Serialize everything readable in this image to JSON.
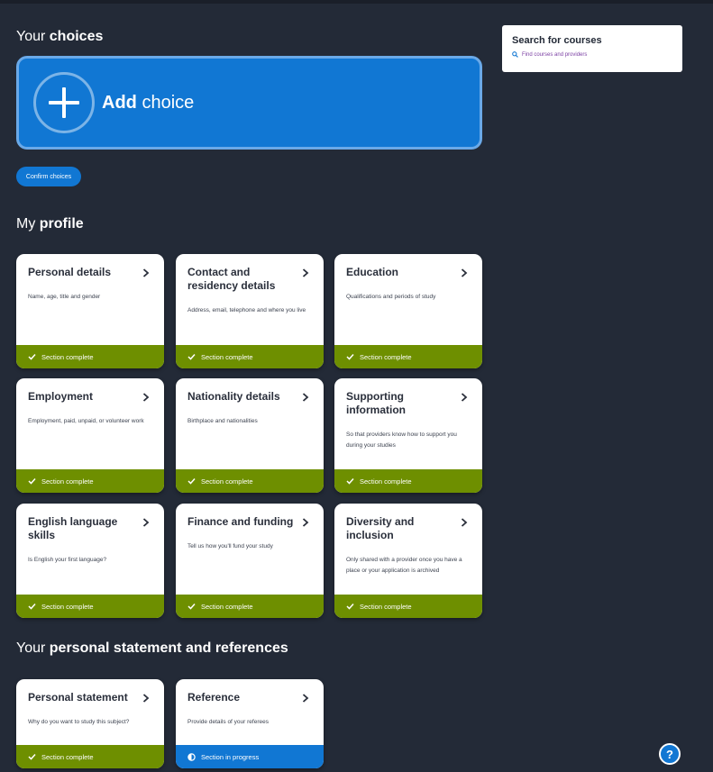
{
  "choices": {
    "heading_prefix": "Your",
    "heading_bold": "choices",
    "add_choice_bold": "Add",
    "add_choice_rest": "choice",
    "confirm_label": "Confirm choices"
  },
  "search": {
    "title": "Search for courses",
    "link": "Find courses and providers"
  },
  "profile": {
    "heading_prefix": "My",
    "heading_bold": "profile",
    "cards": [
      {
        "title": "Personal details",
        "desc": "Name, age, title and gender",
        "status": "Section complete"
      },
      {
        "title": "Contact and residency details",
        "desc": "Address, email, telephone and where you live",
        "status": "Section complete"
      },
      {
        "title": "Education",
        "desc": "Qualifications and periods of study",
        "status": "Section complete"
      },
      {
        "title": "Employment",
        "desc": "Employment, paid, unpaid, or volunteer work",
        "status": "Section complete"
      },
      {
        "title": "Nationality details",
        "desc": "Birthplace and nationalities",
        "status": "Section complete"
      },
      {
        "title": "Supporting information",
        "desc": "So that providers know how to support you during your studies",
        "status": "Section complete"
      },
      {
        "title": "English language skills",
        "desc": "Is English your first language?",
        "status": "Section complete"
      },
      {
        "title": "Finance and funding",
        "desc": "Tell us how you'll fund your study",
        "status": "Section complete"
      },
      {
        "title": "Diversity and inclusion",
        "desc": "Only shared with a provider once you have a place or your application is archived",
        "status": "Section complete"
      }
    ]
  },
  "statement": {
    "heading_prefix": "Your",
    "heading_bold": "personal statement and references",
    "cards": [
      {
        "title": "Personal statement",
        "desc": "Why do you want to study this subject?",
        "status": "Section complete"
      },
      {
        "title": "Reference",
        "desc": "Provide details of your referees",
        "status": "Section in progress"
      }
    ]
  },
  "help": {
    "label": "?"
  },
  "colors": {
    "background": "#232a37",
    "accent_blue": "#1177d3",
    "complete_green": "#6e8f00",
    "card_white": "#ffffff"
  },
  "icons": {
    "add": "plus-icon",
    "card_arrow": "chevron-right-icon",
    "complete": "check-icon",
    "in_progress": "half-circle-icon",
    "search": "magnifier-icon"
  }
}
